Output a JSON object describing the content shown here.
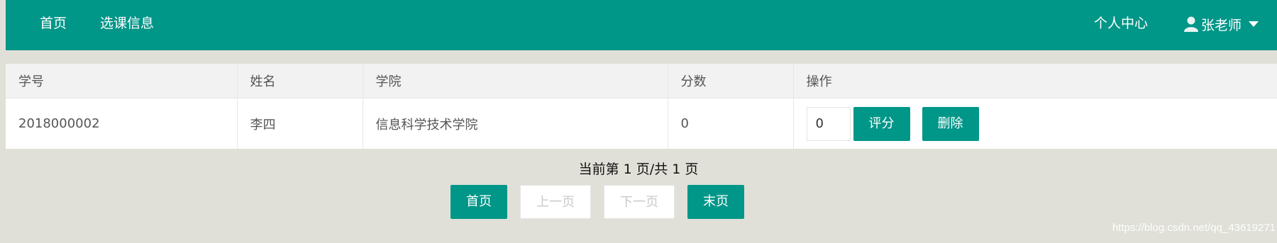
{
  "nav": {
    "home": "首页",
    "course_info": "选课信息",
    "personal_center": "个人中心",
    "user_name": "张老师"
  },
  "table": {
    "headers": [
      "学号",
      "姓名",
      "学院",
      "分数",
      "操作"
    ],
    "rows": [
      {
        "student_id": "2018000002",
        "name": "李四",
        "college": "信息科学技术学院",
        "score": "0",
        "score_input": "0",
        "grade_label": "评分",
        "delete_label": "删除"
      }
    ]
  },
  "pager": {
    "info": "当前第 1 页/共 1 页",
    "first": "首页",
    "prev": "上一页",
    "next": "下一页",
    "last": "末页"
  },
  "watermark": "https://blog.csdn.net/qq_43619271",
  "colors": {
    "primary": "#009688",
    "background": "#e0e0d8"
  }
}
